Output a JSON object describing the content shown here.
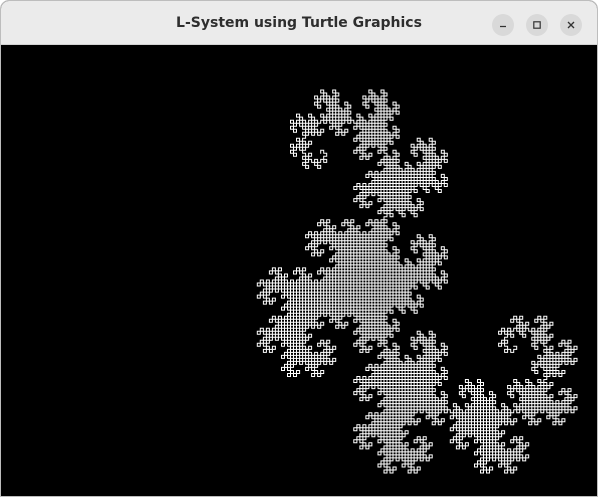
{
  "window": {
    "title": "L-System using Turtle Graphics"
  },
  "titlebar": {
    "buttons": [
      {
        "name": "minimize",
        "icon": "minimize-icon"
      },
      {
        "name": "maximize",
        "icon": "maximize-icon"
      },
      {
        "name": "close",
        "icon": "close-icon"
      }
    ]
  },
  "canvas": {
    "background": "#000000",
    "stroke_color": "#ffffff",
    "drawing": "heighway-dragon-curve"
  }
}
